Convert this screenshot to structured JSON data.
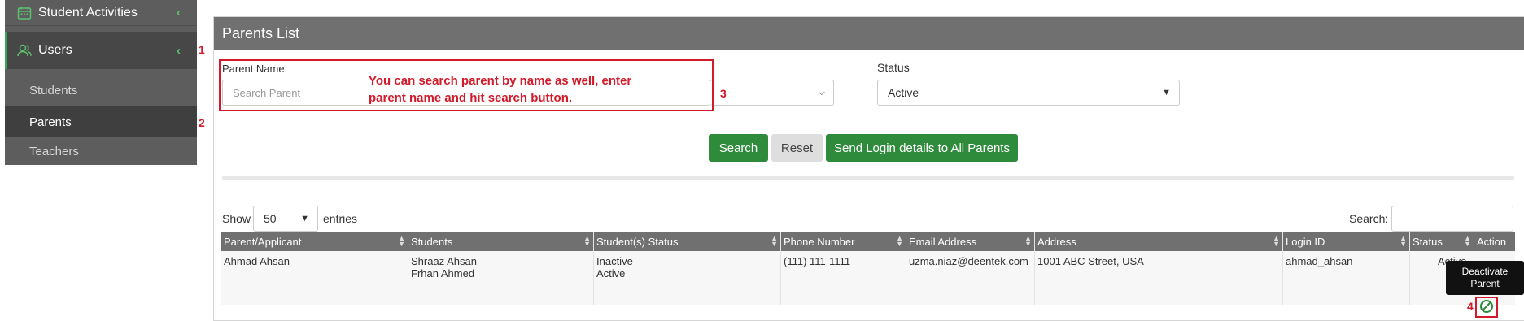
{
  "sidebar": {
    "top_item": "Student Activities",
    "users": "Users",
    "students": "Students",
    "parents": "Parents",
    "teachers": "Teachers"
  },
  "markers": {
    "m1": "1",
    "m2": "2",
    "m3": "3",
    "m4": "4"
  },
  "panel": {
    "title": "Parents List",
    "parent_name_label": "Parent Name",
    "search_placeholder": "Search Parent",
    "callout_line1": "You can search parent by name as well, enter",
    "callout_line2": "parent name and hit search button.",
    "status_label": "Status",
    "status_value": "Active",
    "search_button": "Search",
    "reset_button": "Reset",
    "send_button": "Send Login details to All Parents"
  },
  "table_controls": {
    "show": "Show",
    "entries_value": "50",
    "entries": "entries",
    "search_label": "Search:"
  },
  "table": {
    "columns": [
      "Parent/Applicant",
      "Students",
      "Student(s) Status",
      "Phone Number",
      "Email Address",
      "Address",
      "Login ID",
      "Status",
      "Action"
    ],
    "row": {
      "parent": "Ahmad Ahsan",
      "student1": "Shraaz Ahsan",
      "student2": "Frhan Ahmed",
      "status1": "Inactive",
      "status2": "Active",
      "phone": "(111) 111-1111",
      "email": "uzma.niaz@deentek.com",
      "address": "1001 ABC Street, USA",
      "login": "ahmad_ahsan",
      "status": "Active"
    }
  },
  "tooltip": {
    "line1": "Deactivate",
    "line2": "Parent"
  },
  "icons": [
    "calendar-icon",
    "users-icon",
    "chevron-left-icon",
    "sort-icon",
    "ban-icon"
  ],
  "colors": {
    "accent_green": "#2e8b3c",
    "annotation_red": "#d11a2a",
    "header_gray": "#707070"
  }
}
